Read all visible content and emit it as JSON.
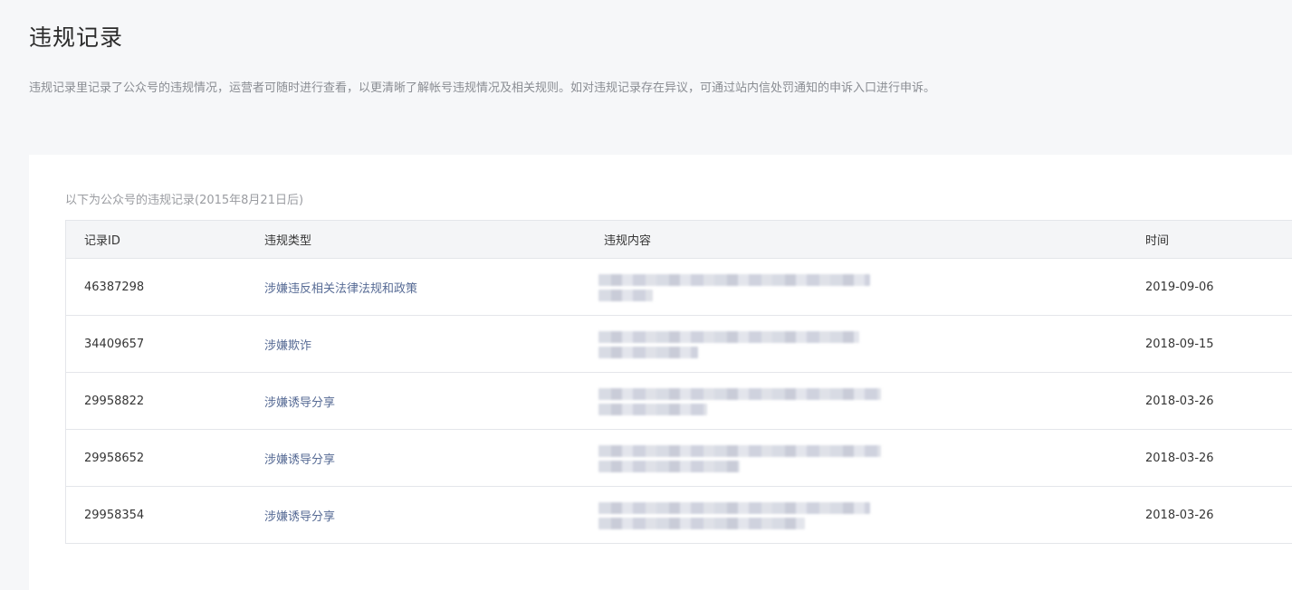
{
  "page": {
    "title": "违规记录",
    "description": "违规记录里记录了公众号的违规情况，运营者可随时进行查看，以更清晰了解帐号违规情况及相关规则。如对违规记录存在异议，可通过站内信处罚通知的申诉入口进行申诉。"
  },
  "panel": {
    "subtitle": "以下为公众号的违规记录(2015年8月21日后)"
  },
  "table": {
    "headers": {
      "id": "记录ID",
      "type": "违规类型",
      "content": "违规内容",
      "time": "时间"
    },
    "rows": [
      {
        "id": "46387298",
        "type": "涉嫌违反相关法律法规和政策",
        "time": "2019-09-06"
      },
      {
        "id": "34409657",
        "type": "涉嫌欺诈",
        "time": "2018-09-15"
      },
      {
        "id": "29958822",
        "type": "涉嫌诱导分享",
        "time": "2018-03-26"
      },
      {
        "id": "29958652",
        "type": "涉嫌诱导分享",
        "time": "2018-03-26"
      },
      {
        "id": "29958354",
        "type": "涉嫌诱导分享",
        "time": "2018-03-26"
      }
    ]
  }
}
